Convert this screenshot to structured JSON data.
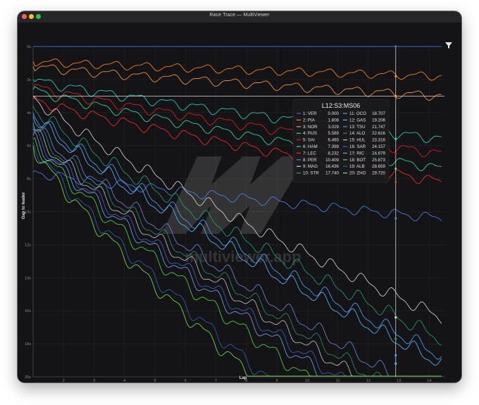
{
  "window": {
    "title": "Race Trace — MultiViewer"
  },
  "watermark": {
    "text": "multiviewer.app"
  },
  "filter": {
    "icon": "filter-icon"
  },
  "tooltip": {
    "title": "L12:S3:MS06",
    "entries": [
      {
        "label": "1: VER",
        "gap": "0.000",
        "color": "#3b6fd8"
      },
      {
        "label": "2: PIA",
        "gap": "1.808",
        "color": "#ff8a1c"
      },
      {
        "label": "3: NOR",
        "gap": "3.029",
        "color": "#ff9a3c"
      },
      {
        "label": "4: RUS",
        "gap": "5.589",
        "color": "#27d6c0"
      },
      {
        "label": "5: SAI",
        "gap": "6.465",
        "color": "#e0202a"
      },
      {
        "label": "6: HAM",
        "gap": "7.399",
        "color": "#33e0a8"
      },
      {
        "label": "7: LEC",
        "gap": "8.232",
        "color": "#ff2a2a"
      },
      {
        "label": "8: PER",
        "gap": "10.409",
        "color": "#4a86e8"
      },
      {
        "label": "9: MAG",
        "gap": "16.436",
        "color": "#d8d8d8"
      },
      {
        "label": "10: STR",
        "gap": "17.740",
        "color": "#1fa07a"
      },
      {
        "label": "11: OCO",
        "gap": "18.707",
        "color": "#4aa3ff"
      },
      {
        "label": "12: GAS",
        "gap": "19.206",
        "color": "#5ab8ff"
      },
      {
        "label": "13: TSU",
        "gap": "21.747",
        "color": "#6f84d8"
      },
      {
        "label": "14: ALO",
        "gap": "22.616",
        "color": "#2a8f6f"
      },
      {
        "label": "15: HUL",
        "gap": "23.316",
        "color": "#c0c0c0"
      },
      {
        "label": "16: SAR",
        "gap": "24.157",
        "color": "#3f62c8"
      },
      {
        "label": "17: RIC",
        "gap": "24.679",
        "color": "#7aa0e8"
      },
      {
        "label": "18: BOT",
        "gap": "25.873",
        "color": "#52d64a"
      },
      {
        "label": "19: ALB",
        "gap": "28.659",
        "color": "#2f5fb8"
      },
      {
        "label": "20: ZHO",
        "gap": "29.720",
        "color": "#7be04a"
      }
    ]
  },
  "chart_data": {
    "type": "line",
    "xlabel": "Lap",
    "ylabel": "Gap to leader",
    "xlim": [
      1,
      14.5
    ],
    "ylim": [
      0,
      20
    ],
    "x_ticks": [
      "2",
      "3",
      "4",
      "5",
      "6",
      "7",
      "8",
      "9",
      "10",
      "11",
      "12",
      "13",
      "14"
    ],
    "y_ticks": [
      "0s",
      "2s",
      "4s",
      "6s",
      "8s",
      "10s",
      "12s",
      "14s",
      "16s",
      "18s",
      "20s"
    ],
    "cursor_lap": 12.9,
    "series": [
      {
        "name": "VER",
        "color": "#3b6fd8",
        "end_gap": 0.0,
        "start_gap": 0.0,
        "wave": 0.0
      },
      {
        "name": "PIA",
        "color": "#ff8a1c",
        "end_gap": 1.8,
        "start_gap": 0.9,
        "wave": 0.25
      },
      {
        "name": "NOR",
        "color": "#ff9a3c",
        "end_gap": 3.0,
        "start_gap": 1.2,
        "wave": 0.28
      },
      {
        "name": "RUS",
        "color": "#27d6c0",
        "end_gap": 5.6,
        "start_gap": 2.0,
        "wave": 0.3
      },
      {
        "name": "SAI",
        "color": "#e0202a",
        "end_gap": 6.5,
        "start_gap": 2.4,
        "wave": 0.3
      },
      {
        "name": "HAM",
        "color": "#33e0a8",
        "end_gap": 7.4,
        "start_gap": 2.6,
        "wave": 0.3
      },
      {
        "name": "LEC",
        "color": "#ff2a2a",
        "end_gap": 8.2,
        "start_gap": 3.2,
        "wave": 0.32
      },
      {
        "name": "PER",
        "color": "#4a86e8",
        "end_gap": 10.4,
        "start_gap": 7.6,
        "wave": 0.3
      },
      {
        "name": "MAG",
        "color": "#d8d8d8",
        "end_gap": 16.4,
        "start_gap": 3.0,
        "wave": 0.4
      },
      {
        "name": "STR",
        "color": "#1fa07a",
        "end_gap": 17.7,
        "start_gap": 3.6,
        "wave": 0.45
      },
      {
        "name": "OCO",
        "color": "#4aa3ff",
        "end_gap": 18.7,
        "start_gap": 4.0,
        "wave": 0.45
      },
      {
        "name": "GAS",
        "color": "#5ab8ff",
        "end_gap": 19.2,
        "start_gap": 4.2,
        "wave": 0.45
      },
      {
        "name": "TSU",
        "color": "#6f84d8",
        "end_gap": 21.7,
        "start_gap": 4.6,
        "wave": 0.45
      },
      {
        "name": "ALO",
        "color": "#2a8f6f",
        "end_gap": 22.6,
        "start_gap": 4.8,
        "wave": 0.45
      },
      {
        "name": "HUL",
        "color": "#c0c0c0",
        "end_gap": 23.3,
        "start_gap": 5.0,
        "wave": 0.45
      },
      {
        "name": "SAR",
        "color": "#3f62c8",
        "end_gap": 24.2,
        "start_gap": 5.2,
        "wave": 0.45
      },
      {
        "name": "RIC",
        "color": "#7aa0e8",
        "end_gap": 24.7,
        "start_gap": 5.4,
        "wave": 0.45
      },
      {
        "name": "BOT",
        "color": "#52d64a",
        "end_gap": 25.9,
        "start_gap": 5.6,
        "wave": 0.45
      },
      {
        "name": "ALB",
        "color": "#2f5fb8",
        "end_gap": 28.7,
        "start_gap": 5.8,
        "wave": 0.45
      },
      {
        "name": "ZHO",
        "color": "#7be04a",
        "end_gap": 29.7,
        "start_gap": 6.0,
        "wave": 0.45
      }
    ]
  }
}
